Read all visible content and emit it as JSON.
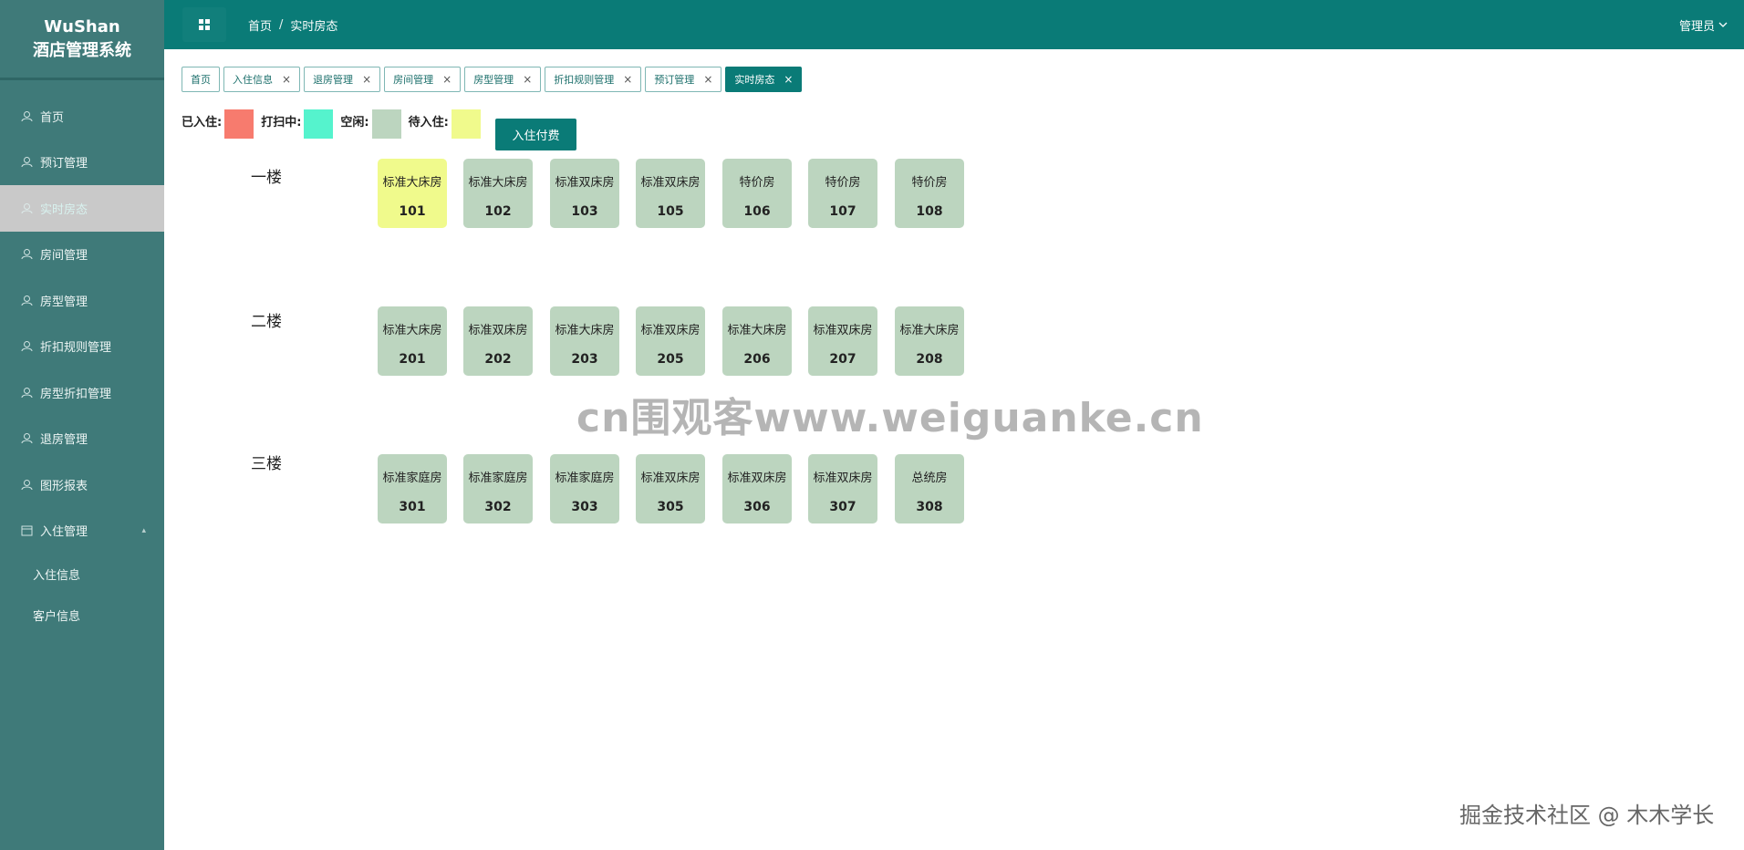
{
  "brand": {
    "line1": "WuShan",
    "line2": "酒店管理系统"
  },
  "sidebar": {
    "items": [
      {
        "label": "首页",
        "icon": "user-icon"
      },
      {
        "label": "预订管理",
        "icon": "user-icon"
      },
      {
        "label": "实时房态",
        "icon": "user-icon",
        "active": true
      },
      {
        "label": "房间管理",
        "icon": "user-icon"
      },
      {
        "label": "房型管理",
        "icon": "user-icon"
      },
      {
        "label": "折扣规则管理",
        "icon": "user-icon"
      },
      {
        "label": "房型折扣管理",
        "icon": "user-icon"
      },
      {
        "label": "退房管理",
        "icon": "user-icon"
      },
      {
        "label": "图形报表",
        "icon": "user-icon"
      },
      {
        "label": "入住管理",
        "icon": "calendar-icon"
      }
    ],
    "submenu": [
      "入住信息",
      "客户信息"
    ]
  },
  "header": {
    "breadcrumb": [
      "首页",
      "实时房态"
    ],
    "separator": "/",
    "user": "管理员"
  },
  "tabs": [
    {
      "label": "首页",
      "closable": false
    },
    {
      "label": "入住信息",
      "closable": true
    },
    {
      "label": "退房管理",
      "closable": true
    },
    {
      "label": "房间管理",
      "closable": true
    },
    {
      "label": "房型管理",
      "closable": true
    },
    {
      "label": "折扣规则管理",
      "closable": true
    },
    {
      "label": "预订管理",
      "closable": true
    },
    {
      "label": "实时房态",
      "closable": true,
      "active": true
    }
  ],
  "legend": [
    {
      "label": "已入住:",
      "color": "#f77b6e"
    },
    {
      "label": "打扫中:",
      "color": "#55f3cd"
    },
    {
      "label": "空闲:",
      "color": "#bcd5bf"
    },
    {
      "label": "待入住:",
      "color": "#f0fa8c"
    }
  ],
  "pay_button": "入住付费",
  "colors": {
    "free": "#bcd5bf",
    "pending": "#f0fa8c",
    "occupied": "#f77b6e",
    "cleaning": "#55f3cd"
  },
  "floors": [
    {
      "name": "一楼",
      "rooms": [
        {
          "type": "标准大床房",
          "number": "101",
          "status": "pending"
        },
        {
          "type": "标准大床房",
          "number": "102",
          "status": "free"
        },
        {
          "type": "标准双床房",
          "number": "103",
          "status": "free"
        },
        {
          "type": "标准双床房",
          "number": "105",
          "status": "free"
        },
        {
          "type": "特价房",
          "number": "106",
          "status": "free"
        },
        {
          "type": "特价房",
          "number": "107",
          "status": "free"
        },
        {
          "type": "特价房",
          "number": "108",
          "status": "free"
        }
      ]
    },
    {
      "name": "二楼",
      "rooms": [
        {
          "type": "标准大床房",
          "number": "201",
          "status": "free"
        },
        {
          "type": "标准双床房",
          "number": "202",
          "status": "free"
        },
        {
          "type": "标准大床房",
          "number": "203",
          "status": "free"
        },
        {
          "type": "标准双床房",
          "number": "205",
          "status": "free"
        },
        {
          "type": "标准大床房",
          "number": "206",
          "status": "free"
        },
        {
          "type": "标准双床房",
          "number": "207",
          "status": "free"
        },
        {
          "type": "标准大床房",
          "number": "208",
          "status": "free"
        }
      ]
    },
    {
      "name": "三楼",
      "rooms": [
        {
          "type": "标准家庭房",
          "number": "301",
          "status": "free"
        },
        {
          "type": "标准家庭房",
          "number": "302",
          "status": "free"
        },
        {
          "type": "标准家庭房",
          "number": "303",
          "status": "free"
        },
        {
          "type": "标准双床房",
          "number": "305",
          "status": "free"
        },
        {
          "type": "标准双床房",
          "number": "306",
          "status": "free"
        },
        {
          "type": "标准双床房",
          "number": "307",
          "status": "free"
        },
        {
          "type": "总统房",
          "number": "308",
          "status": "free"
        }
      ]
    }
  ],
  "watermarks": {
    "center": "cn围观客www.weiguanke.cn",
    "bottom_right": "掘金技术社区 @ 木木学长"
  }
}
